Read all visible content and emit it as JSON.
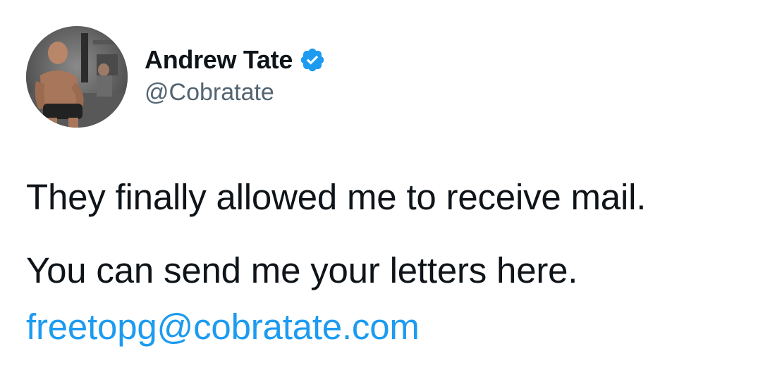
{
  "author": {
    "display_name": "Andrew Tate",
    "handle": "@Cobratate",
    "verified": true,
    "avatar_icon": "profile-photo",
    "verified_icon": "verified-badge-icon"
  },
  "tweet": {
    "line1": "They finally allowed me to receive mail.",
    "line2": "You can send me your letters here.",
    "email": "freetopg@cobratate.com"
  },
  "colors": {
    "text": "#0f1419",
    "handle": "#536471",
    "link": "#1d9bf0",
    "verified": "#1d9bf0"
  }
}
